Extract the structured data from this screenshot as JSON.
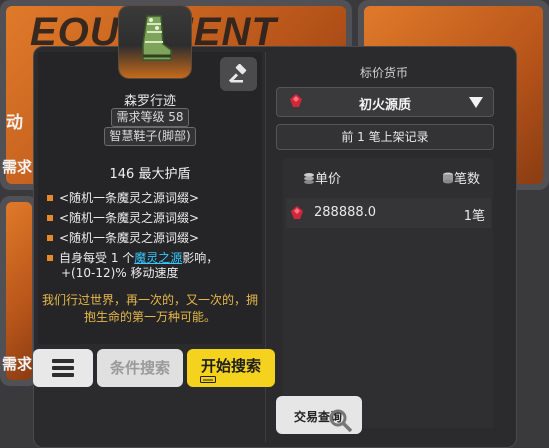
{
  "background": {
    "title": "EQUIPMENT",
    "card_left_label": "动",
    "card_left_label2": "需求",
    "card_left_label3": "需求"
  },
  "item": {
    "name": "森罗行迹",
    "level_req": "需求等级 58",
    "type": "智慧鞋子(脚部)",
    "armor": "146 最大护盾",
    "mods": [
      "<随机一条魔灵之源词缀>",
      "<随机一条魔灵之源词缀>",
      "<随机一条魔灵之源词缀>"
    ],
    "special_mod_prefix": "自身每受 1 个",
    "special_mod_link": "魔灵之源",
    "special_mod_suffix": "影响，",
    "special_mod_line2": "+(10-12)% 移动速度",
    "flavor": "我们行过世界，再一次的，又一次的，拥抱生命的第一万种可能。"
  },
  "market": {
    "currency_label": "标价货币",
    "currency_selected": "初火源质",
    "history_button": "前 1 笔上架记录",
    "col_price": "单价",
    "col_qty": "笔数",
    "rows": [
      {
        "price": "288888.0",
        "qty": "1笔"
      }
    ],
    "query_button": "交易查询"
  },
  "buttons": {
    "condition_search": "条件搜索",
    "start_search": "开始搜索"
  },
  "colors": {
    "accent_orange": "#e07a2a",
    "link_blue": "#33c8ff",
    "flavor_gold": "#e6b84a",
    "start_yellow": "#f4d21e"
  }
}
